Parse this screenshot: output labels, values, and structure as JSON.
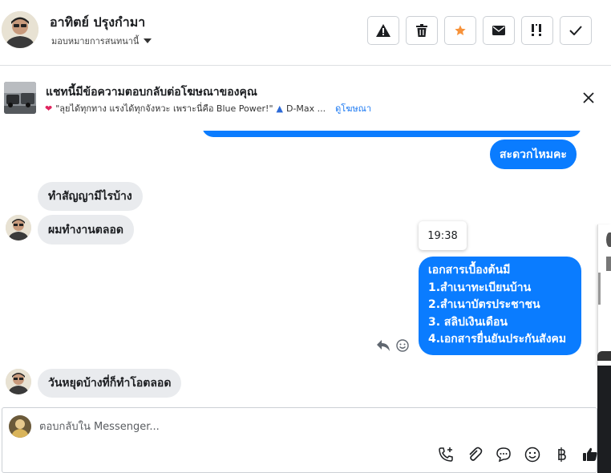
{
  "header": {
    "name": "อาทิตย์ ปรุงกำมา",
    "assign_label": "มอบหมายการสนทนานี้",
    "buttons": [
      {
        "icon": "warning-icon"
      },
      {
        "icon": "trash-icon"
      },
      {
        "icon": "star-icon",
        "color": "#f7923a"
      },
      {
        "icon": "envelope-icon"
      },
      {
        "icon": "priority-icon"
      },
      {
        "icon": "checkmark-icon"
      }
    ]
  },
  "ad_banner": {
    "title": "แชทนี้มีข้อความตอบกลับต่อโฆษณาของคุณ",
    "ad_text": "\"ลุยได้ทุกทาง แรงได้ทุกจังหวะ เพราะนี่คือ Blue Power!\"",
    "ad_suffix": "D-Max ...",
    "link": "ดูโฆษณา"
  },
  "messages": {
    "out_1": "สะดวกไหมคะ",
    "in_1": "ทำสัญญามีไรบ้าง",
    "in_2": "ผมทำงานตลอด",
    "timestamp": "19:38",
    "out_2_lines": [
      "เอกสารเบื้องต้นมี",
      "1.สำเนาทะเบียนบ้าน",
      "2.สำเนาบัตรประชาชน",
      "3. สลิปเงินเดือน",
      "4.เอกสารยื่นยันประกันสังคม"
    ],
    "in_3": "วันหยุดบ้างที่ก็ทำโอตลอด"
  },
  "composer": {
    "placeholder": "ตอบกลับใน Messenger...",
    "icons": [
      "call-add-icon",
      "paperclip-icon",
      "saved-reply-icon",
      "emoji-icon",
      "baht-icon",
      "thumbs-up-icon"
    ]
  },
  "colors": {
    "accent": "#0a7cff",
    "incoming_bubble": "#e9ebee",
    "link": "#1877f2"
  }
}
